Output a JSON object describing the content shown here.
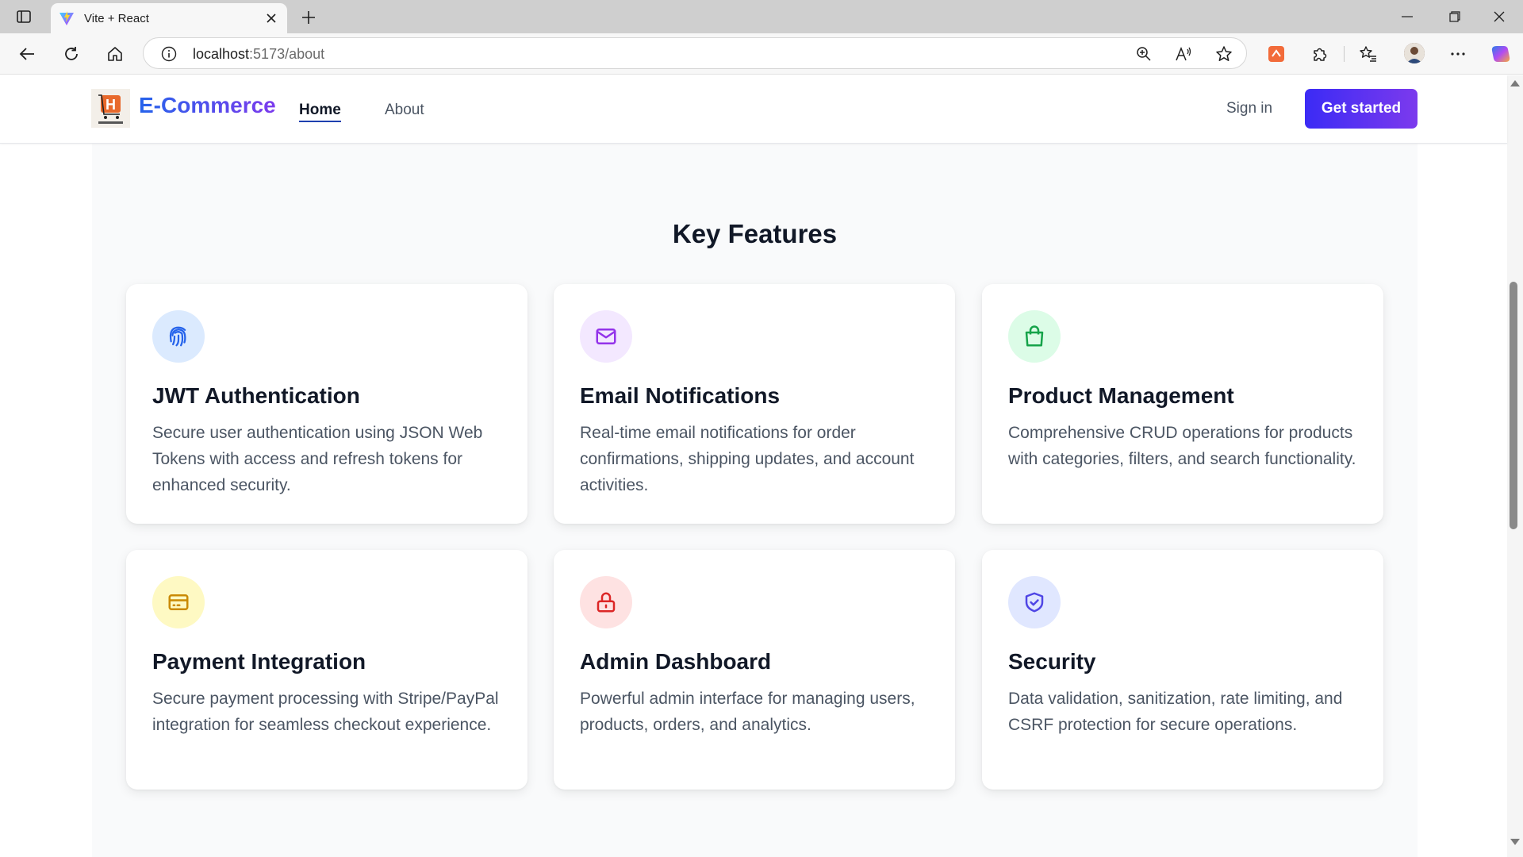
{
  "browser": {
    "tab_title": "Vite + React",
    "url_host": "localhost",
    "url_path": ":5173/about"
  },
  "nav": {
    "brand": "E-Commerce",
    "links": [
      {
        "label": "Home"
      },
      {
        "label": "About"
      }
    ],
    "signin": "Sign in",
    "cta": "Get started"
  },
  "features": {
    "title": "Key Features",
    "items": [
      {
        "icon": "fingerprint-icon",
        "color": "#2563eb",
        "bg": "#dbeafe",
        "title": "JWT Authentication",
        "desc": "Secure user authentication using JSON Web Tokens with access and refresh tokens for enhanced security."
      },
      {
        "icon": "mail-icon",
        "color": "#9333ea",
        "bg": "#f3e8ff",
        "title": "Email Notifications",
        "desc": "Real-time email notifications for order confirmations, shipping updates, and account activities."
      },
      {
        "icon": "shopping-bag-icon",
        "color": "#16a34a",
        "bg": "#dcfce7",
        "title": "Product Management",
        "desc": "Comprehensive CRUD operations for products with categories, filters, and search functionality."
      },
      {
        "icon": "credit-card-icon",
        "color": "#ca8a04",
        "bg": "#fef9c3",
        "title": "Payment Integration",
        "desc": "Secure payment processing with Stripe/PayPal integration for seamless checkout experience."
      },
      {
        "icon": "lock-icon",
        "color": "#dc2626",
        "bg": "#fee2e2",
        "title": "Admin Dashboard",
        "desc": "Powerful admin interface for managing users, products, orders, and analytics."
      },
      {
        "icon": "shield-check-icon",
        "color": "#4f46e5",
        "bg": "#e0e7ff",
        "title": "Security",
        "desc": "Data validation, sanitization, rate limiting, and CSRF protection for secure operations."
      }
    ]
  }
}
